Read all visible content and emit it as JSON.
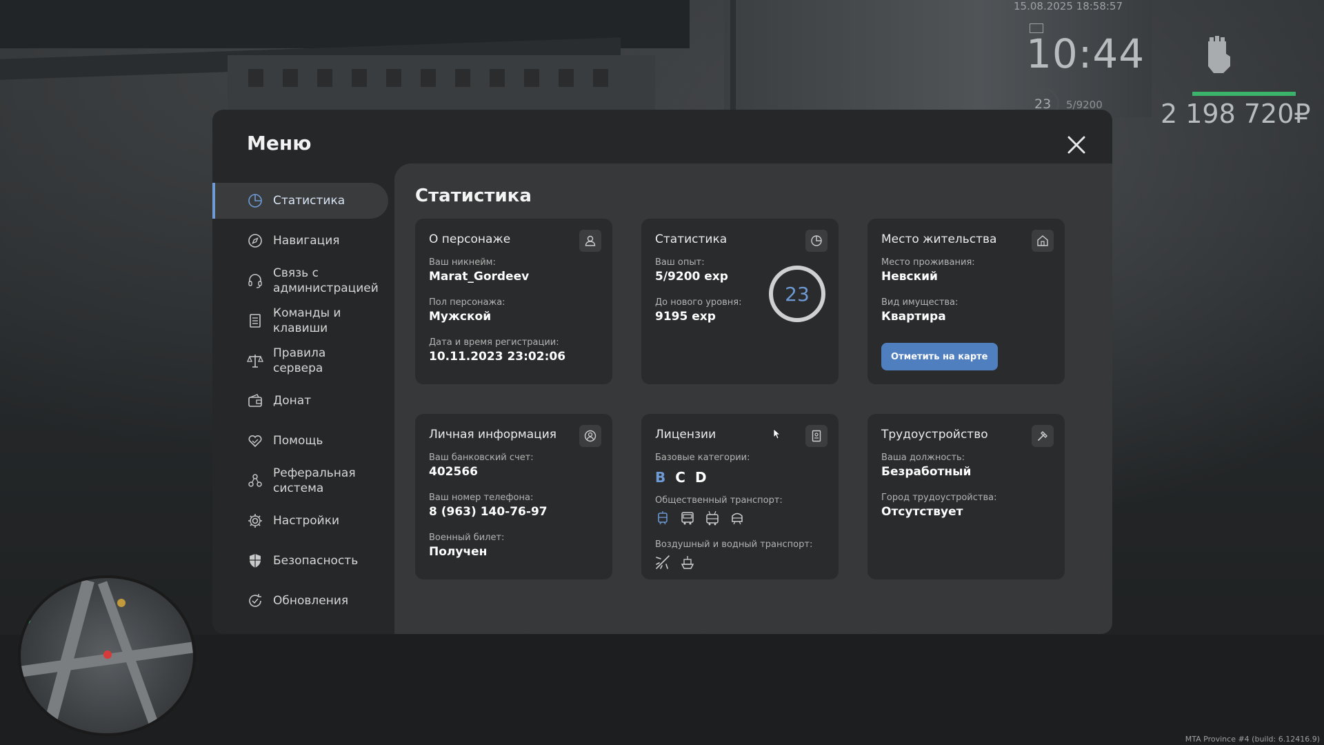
{
  "hud": {
    "datetime": "15.08.2025 18:58:57",
    "time": "10:44",
    "level": "23",
    "exp": "5/9200",
    "money": "2 198 720₽",
    "build": "MTA Province #4 (build: 6.12416.9)"
  },
  "menu": {
    "title": "Меню",
    "sidebar": [
      {
        "label": "Статистика",
        "icon": "stats-pie-icon",
        "active": true
      },
      {
        "label": "Навигация",
        "icon": "compass-icon"
      },
      {
        "label": "Связь с администрацией",
        "icon": "headset-icon"
      },
      {
        "label": "Команды и клавиши",
        "icon": "document-list-icon"
      },
      {
        "label": "Правила сервера",
        "icon": "scales-icon"
      },
      {
        "label": "Донат",
        "icon": "wallet-icon"
      },
      {
        "label": "Помощь",
        "icon": "heart-hand-icon"
      },
      {
        "label": "Реферальная система",
        "icon": "people-network-icon"
      },
      {
        "label": "Настройки",
        "icon": "gear-icon"
      },
      {
        "label": "Безопасность",
        "icon": "shield-icon"
      },
      {
        "label": "Обновления",
        "icon": "refresh-check-icon"
      }
    ]
  },
  "content": {
    "title": "Статистика",
    "character": {
      "title": "О персонаже",
      "icon": "user-icon",
      "nickname_label": "Ваш никнейм:",
      "nickname": "Marat_Gordeev",
      "gender_label": "Пол персонажа:",
      "gender": "Мужской",
      "reg_label": "Дата и время регистрации:",
      "reg": "10.11.2023 23:02:06"
    },
    "stats": {
      "title": "Статистика",
      "icon": "pie-chart-icon",
      "exp_label": "Ваш опыт:",
      "exp": "5/9200 exp",
      "next_label": "До нового уровня:",
      "next": "9195 exp",
      "level": "23"
    },
    "residence": {
      "title": "Место жительства",
      "icon": "house-icon",
      "place_label": "Место проживания:",
      "place": "Невский",
      "property_label": "Вид имущества:",
      "property": "Квартира",
      "map_button": "Отметить на карте"
    },
    "personal": {
      "title": "Личная информация",
      "icon": "user-circle-icon",
      "bank_label": "Ваш банковский счет:",
      "bank": "402566",
      "phone_label": "Ваш номер телефона:",
      "phone": "8 (963) 140-76-97",
      "military_label": "Военный билет:",
      "military": "Получен"
    },
    "licenses": {
      "title": "Лицензии",
      "icon": "license-doc-icon",
      "base_label": "Базовые категории:",
      "categories": [
        {
          "label": "B",
          "active": true
        },
        {
          "label": "C",
          "active": false
        },
        {
          "label": "D",
          "active": false
        }
      ],
      "public_label": "Общественный транспорт:",
      "air_label": "Воздушный и водный транспорт:"
    },
    "employment": {
      "title": "Трудоустройство",
      "icon": "hammer-icon",
      "position_label": "Ваша должность:",
      "position": "Безработный",
      "city_label": "Город трудоустройства:",
      "city": "Отсутствует"
    }
  },
  "colors": {
    "accent": "#6e9bd6",
    "button": "#4f7fbf",
    "health": "#3bb36b"
  }
}
